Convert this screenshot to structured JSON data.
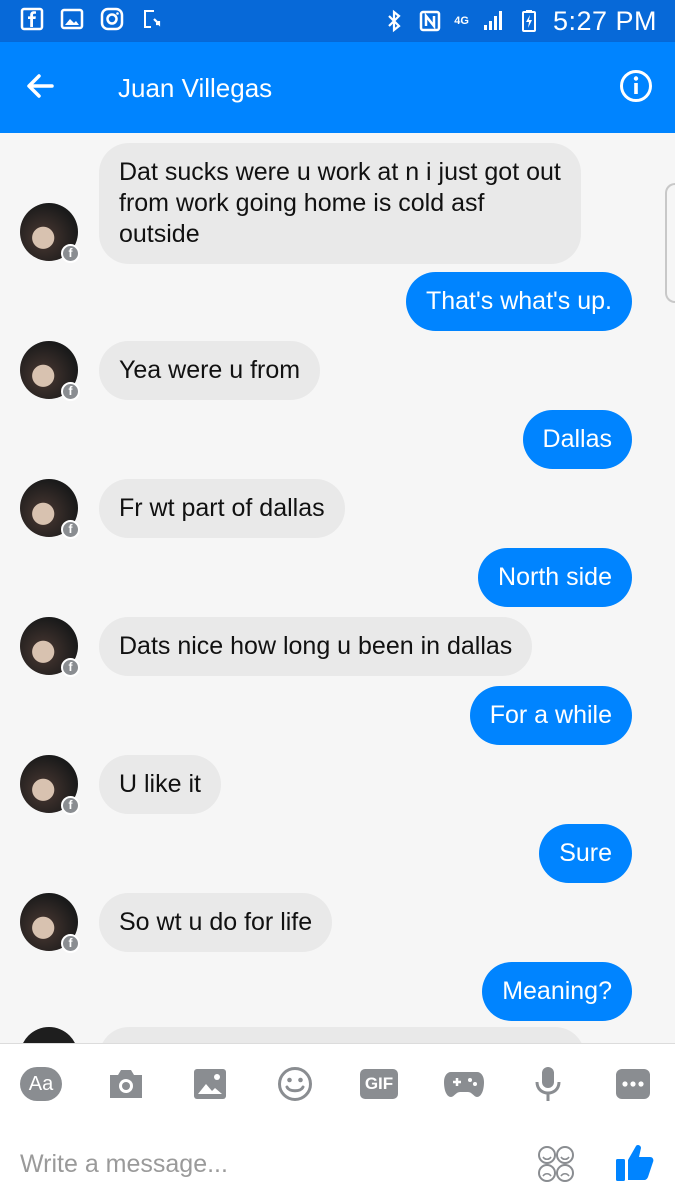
{
  "status_bar": {
    "time": "5:27 PM",
    "network": "4G",
    "left_icons": [
      "facebook-icon",
      "gallery-icon",
      "instagram-icon",
      "download-icon"
    ],
    "right_icons": [
      "bluetooth-icon",
      "nfc-icon",
      "signal-icon",
      "battery-charging-icon"
    ]
  },
  "header": {
    "contact_name": "Juan Villegas",
    "back_icon": "arrow-left-icon",
    "info_icon": "info-icon"
  },
  "messages": [
    {
      "from": "contact",
      "text": "Dat sucks were u work at n i just got out\nfrom work going home is cold asf\noutside"
    },
    {
      "from": "me",
      "text": "That's what's up."
    },
    {
      "from": "contact",
      "text": "Yea were u from"
    },
    {
      "from": "me",
      "text": "Dallas"
    },
    {
      "from": "contact",
      "text": "Fr wt part of dallas"
    },
    {
      "from": "me",
      "text": "North side"
    },
    {
      "from": "contact",
      "text": "Dats nice how long u been in dallas"
    },
    {
      "from": "me",
      "text": "For a while"
    },
    {
      "from": "contact",
      "text": "U like it"
    },
    {
      "from": "me",
      "text": "Sure"
    },
    {
      "from": "contact",
      "text": "So wt u do for life"
    },
    {
      "from": "me",
      "text": "Meaning?"
    }
  ],
  "composer": {
    "placeholder": "Write a message...",
    "tools": [
      {
        "icon": "text-aa-icon",
        "label": "Aa"
      },
      {
        "icon": "camera-icon",
        "label": ""
      },
      {
        "icon": "image-icon",
        "label": ""
      },
      {
        "icon": "emoji-icon",
        "label": ""
      },
      {
        "icon": "gif-icon",
        "label": "GIF"
      },
      {
        "icon": "game-controller-icon",
        "label": ""
      },
      {
        "icon": "microphone-icon",
        "label": ""
      },
      {
        "icon": "more-icon",
        "label": ""
      }
    ],
    "emoji_picker_icon": "emoji-faces-icon",
    "send_icon": "thumbs-up-icon",
    "accent_color": "#0084ff"
  },
  "colors": {
    "header": "#0084ff",
    "status_bar": "#0769d8",
    "outgoing_bubble": "#0084ff",
    "incoming_bubble": "#e9e9e9"
  }
}
